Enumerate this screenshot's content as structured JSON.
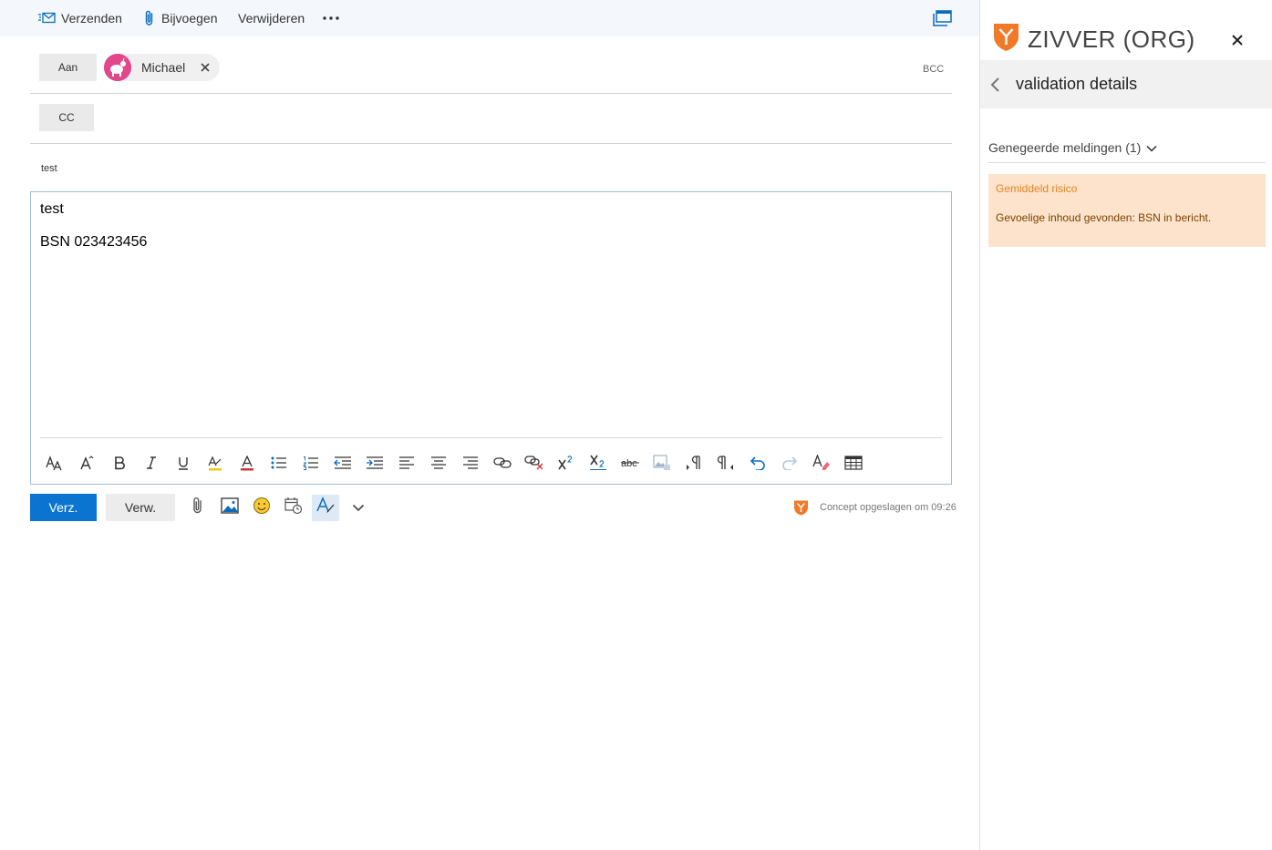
{
  "command_bar": {
    "send_label": "Verzenden",
    "attach_label": "Bijvoegen",
    "discard_label": "Verwijderen"
  },
  "recipients": {
    "to_label": "Aan",
    "cc_label": "CC",
    "bcc_label": "BCC",
    "to": [
      {
        "name": "Michael"
      }
    ]
  },
  "subject": "test",
  "body": {
    "lines": [
      "test",
      "BSN 023423456"
    ]
  },
  "format_toolbar": {
    "icons": [
      "font-size-icon",
      "grow-font-icon",
      "bold-icon",
      "italic-icon",
      "underline-icon",
      "highlight-icon",
      "font-color-icon",
      "bullets-icon",
      "numbering-icon",
      "decrease-indent-icon",
      "increase-indent-icon",
      "align-left-icon",
      "align-center-icon",
      "align-right-icon",
      "insert-link-icon",
      "remove-link-icon",
      "superscript-icon",
      "subscript-icon",
      "strikethrough-icon",
      "insert-image-icon",
      "ltr-icon",
      "rtl-icon",
      "undo-icon",
      "redo-icon",
      "clear-formatting-icon",
      "insert-table-icon"
    ]
  },
  "bottom_bar": {
    "send_label": "Verz.",
    "discard_label": "Verw.",
    "status": "Concept opgeslagen om 09:26"
  },
  "addin": {
    "title": "ZIVVER (ORG)",
    "subheader": "validation details",
    "ignored_label": "Genegeerde meldingen (1)",
    "risk": {
      "level": "Gemiddeld risico",
      "message": "Gevoelige inhoud gevonden: BSN in bericht."
    }
  },
  "colors": {
    "accent": "#0b74d1",
    "zivver_orange": "#f07a2a",
    "risk_background": "#fde3cc",
    "risk_title": "#e8821e"
  }
}
